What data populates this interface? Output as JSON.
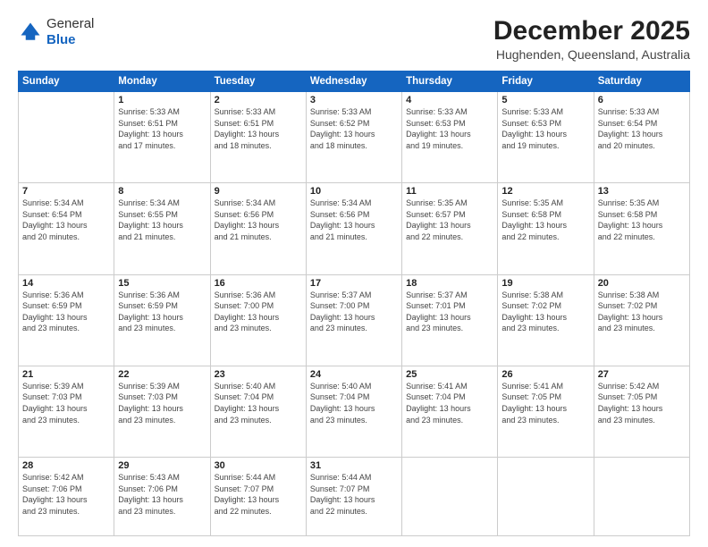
{
  "header": {
    "logo_general": "General",
    "logo_blue": "Blue",
    "title": "December 2025",
    "subtitle": "Hughenden, Queensland, Australia"
  },
  "days_of_week": [
    "Sunday",
    "Monday",
    "Tuesday",
    "Wednesday",
    "Thursday",
    "Friday",
    "Saturday"
  ],
  "weeks": [
    [
      {
        "day": "",
        "info": ""
      },
      {
        "day": "1",
        "info": "Sunrise: 5:33 AM\nSunset: 6:51 PM\nDaylight: 13 hours\nand 17 minutes."
      },
      {
        "day": "2",
        "info": "Sunrise: 5:33 AM\nSunset: 6:51 PM\nDaylight: 13 hours\nand 18 minutes."
      },
      {
        "day": "3",
        "info": "Sunrise: 5:33 AM\nSunset: 6:52 PM\nDaylight: 13 hours\nand 18 minutes."
      },
      {
        "day": "4",
        "info": "Sunrise: 5:33 AM\nSunset: 6:53 PM\nDaylight: 13 hours\nand 19 minutes."
      },
      {
        "day": "5",
        "info": "Sunrise: 5:33 AM\nSunset: 6:53 PM\nDaylight: 13 hours\nand 19 minutes."
      },
      {
        "day": "6",
        "info": "Sunrise: 5:33 AM\nSunset: 6:54 PM\nDaylight: 13 hours\nand 20 minutes."
      }
    ],
    [
      {
        "day": "7",
        "info": "Sunrise: 5:34 AM\nSunset: 6:54 PM\nDaylight: 13 hours\nand 20 minutes."
      },
      {
        "day": "8",
        "info": "Sunrise: 5:34 AM\nSunset: 6:55 PM\nDaylight: 13 hours\nand 21 minutes."
      },
      {
        "day": "9",
        "info": "Sunrise: 5:34 AM\nSunset: 6:56 PM\nDaylight: 13 hours\nand 21 minutes."
      },
      {
        "day": "10",
        "info": "Sunrise: 5:34 AM\nSunset: 6:56 PM\nDaylight: 13 hours\nand 21 minutes."
      },
      {
        "day": "11",
        "info": "Sunrise: 5:35 AM\nSunset: 6:57 PM\nDaylight: 13 hours\nand 22 minutes."
      },
      {
        "day": "12",
        "info": "Sunrise: 5:35 AM\nSunset: 6:58 PM\nDaylight: 13 hours\nand 22 minutes."
      },
      {
        "day": "13",
        "info": "Sunrise: 5:35 AM\nSunset: 6:58 PM\nDaylight: 13 hours\nand 22 minutes."
      }
    ],
    [
      {
        "day": "14",
        "info": "Sunrise: 5:36 AM\nSunset: 6:59 PM\nDaylight: 13 hours\nand 23 minutes."
      },
      {
        "day": "15",
        "info": "Sunrise: 5:36 AM\nSunset: 6:59 PM\nDaylight: 13 hours\nand 23 minutes."
      },
      {
        "day": "16",
        "info": "Sunrise: 5:36 AM\nSunset: 7:00 PM\nDaylight: 13 hours\nand 23 minutes."
      },
      {
        "day": "17",
        "info": "Sunrise: 5:37 AM\nSunset: 7:00 PM\nDaylight: 13 hours\nand 23 minutes."
      },
      {
        "day": "18",
        "info": "Sunrise: 5:37 AM\nSunset: 7:01 PM\nDaylight: 13 hours\nand 23 minutes."
      },
      {
        "day": "19",
        "info": "Sunrise: 5:38 AM\nSunset: 7:02 PM\nDaylight: 13 hours\nand 23 minutes."
      },
      {
        "day": "20",
        "info": "Sunrise: 5:38 AM\nSunset: 7:02 PM\nDaylight: 13 hours\nand 23 minutes."
      }
    ],
    [
      {
        "day": "21",
        "info": "Sunrise: 5:39 AM\nSunset: 7:03 PM\nDaylight: 13 hours\nand 23 minutes."
      },
      {
        "day": "22",
        "info": "Sunrise: 5:39 AM\nSunset: 7:03 PM\nDaylight: 13 hours\nand 23 minutes."
      },
      {
        "day": "23",
        "info": "Sunrise: 5:40 AM\nSunset: 7:04 PM\nDaylight: 13 hours\nand 23 minutes."
      },
      {
        "day": "24",
        "info": "Sunrise: 5:40 AM\nSunset: 7:04 PM\nDaylight: 13 hours\nand 23 minutes."
      },
      {
        "day": "25",
        "info": "Sunrise: 5:41 AM\nSunset: 7:04 PM\nDaylight: 13 hours\nand 23 minutes."
      },
      {
        "day": "26",
        "info": "Sunrise: 5:41 AM\nSunset: 7:05 PM\nDaylight: 13 hours\nand 23 minutes."
      },
      {
        "day": "27",
        "info": "Sunrise: 5:42 AM\nSunset: 7:05 PM\nDaylight: 13 hours\nand 23 minutes."
      }
    ],
    [
      {
        "day": "28",
        "info": "Sunrise: 5:42 AM\nSunset: 7:06 PM\nDaylight: 13 hours\nand 23 minutes."
      },
      {
        "day": "29",
        "info": "Sunrise: 5:43 AM\nSunset: 7:06 PM\nDaylight: 13 hours\nand 23 minutes."
      },
      {
        "day": "30",
        "info": "Sunrise: 5:44 AM\nSunset: 7:07 PM\nDaylight: 13 hours\nand 22 minutes."
      },
      {
        "day": "31",
        "info": "Sunrise: 5:44 AM\nSunset: 7:07 PM\nDaylight: 13 hours\nand 22 minutes."
      },
      {
        "day": "",
        "info": ""
      },
      {
        "day": "",
        "info": ""
      },
      {
        "day": "",
        "info": ""
      }
    ]
  ]
}
